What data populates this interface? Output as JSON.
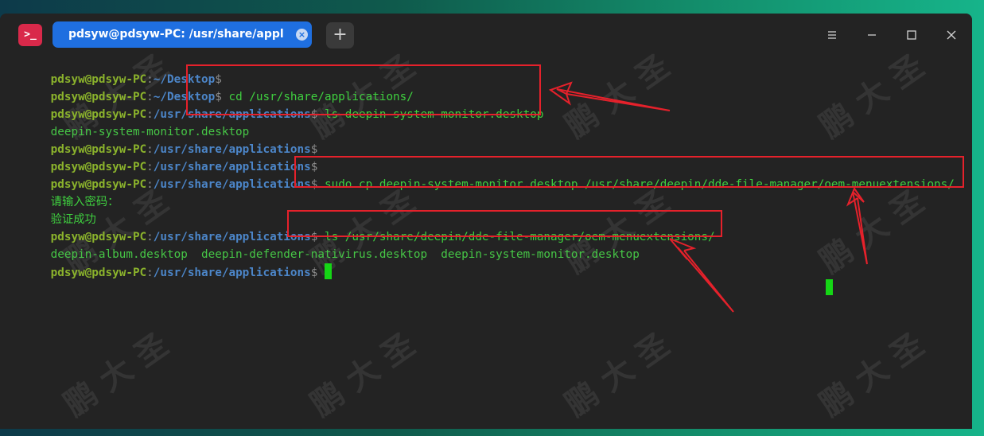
{
  "window": {
    "tab_title": "pdsyw@pdsyw-PC: /usr/share/applications",
    "icon_glyph": ">_",
    "add_tab_glyph": "+",
    "tab_close_glyph": "×"
  },
  "colors": {
    "tab_active": "#1f6fe0",
    "user": "#8bb32c",
    "path": "#4c86c9",
    "command": "#3fcf3f",
    "annotation": "#e5212b"
  },
  "icons": [
    "terminal-app-icon",
    "close-tab-icon",
    "add-tab-icon",
    "menu-icon",
    "minimize-icon",
    "maximize-icon",
    "close-icon"
  ],
  "terminal": {
    "lines": [
      {
        "user": "pdsyw@pdsyw-PC",
        "sep": ":",
        "path": "~/Desktop",
        "prompt": "$",
        "cmd": ""
      },
      {
        "user": "pdsyw@pdsyw-PC",
        "sep": ":",
        "path": "~/Desktop",
        "prompt": "$",
        "cmd": " cd /usr/share/applications/"
      },
      {
        "user": "pdsyw@pdsyw-PC",
        "sep": ":",
        "path": "/usr/share/applications",
        "prompt": "$",
        "cmd": " ls deepin-system-monitor.desktop"
      },
      {
        "output": "deepin-system-monitor.desktop"
      },
      {
        "user": "pdsyw@pdsyw-PC",
        "sep": ":",
        "path": "/usr/share/applications",
        "prompt": "$",
        "cmd": ""
      },
      {
        "user": "pdsyw@pdsyw-PC",
        "sep": ":",
        "path": "/usr/share/applications",
        "prompt": "$",
        "cmd": ""
      },
      {
        "user": "pdsyw@pdsyw-PC",
        "sep": ":",
        "path": "/usr/share/applications",
        "prompt": "$",
        "cmd": " sudo cp deepin-system-monitor.desktop /usr/share/deepin/dde-file-manager/oem-menuextensions/"
      },
      {
        "output_cn": "请输入密码："
      },
      {
        "output_cn": "验证成功"
      },
      {
        "user": "pdsyw@pdsyw-PC",
        "sep": ":",
        "path": "/usr/share/applications",
        "prompt": "$",
        "cmd": " ls /usr/share/deepin/dde-file-manager/oem-menuextensions/"
      },
      {
        "output": "deepin-album.desktop  deepin-defender-nativirus.desktop  deepin-system-monitor.desktop"
      },
      {
        "user": "pdsyw@pdsyw-PC",
        "sep": ":",
        "path": "/usr/share/applications",
        "prompt": "$",
        "cmd": " "
      }
    ]
  },
  "watermark": "鹏 大 圣"
}
